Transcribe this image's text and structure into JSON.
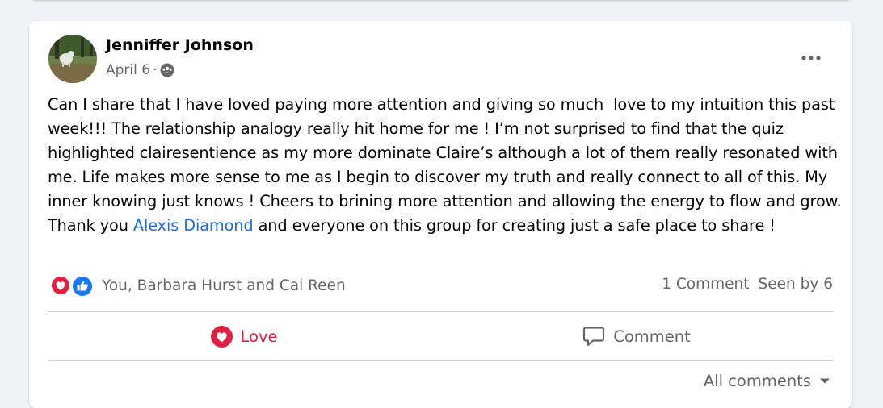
{
  "post": {
    "author": "Jenniffer Johnson",
    "date": "April 6",
    "separator": "·",
    "audience_icon": "group-icon",
    "more_icon": "more-options-icon",
    "body_before_mention": "Can I share that I have loved paying more attention and giving so much  love to my intuition this past week!!! The relationship analogy really hit home for me ! I’m not surprised to find that the quiz highlighted clairesentience as my more dominate Claire’s although a lot of them really resonated with me. Life makes more sense to me as I begin to discover my truth and really connect to all of this. My inner knowing just knows ! Cheers to brining more attention and allowing the energy to flow and grow. Thank you ",
    "mention": "Alexis Diamond",
    "body_after_mention": " and everyone on this group for creating just a safe place to share !"
  },
  "reactions": {
    "icons": [
      "love-reaction-icon",
      "like-reaction-icon"
    ],
    "names": "You, Barbara Hurst and Cai Reen",
    "comments_count": "1 Comment",
    "seen_by": "Seen by 6"
  },
  "actions": {
    "love_label": "Love",
    "comment_label": "Comment"
  },
  "footer": {
    "all_comments_label": "All comments"
  },
  "colors": {
    "love": "#e41e3f",
    "like": "#1877f2",
    "link": "#216fdb",
    "secondary_text": "#65676b",
    "background": "#f0f2f5"
  }
}
